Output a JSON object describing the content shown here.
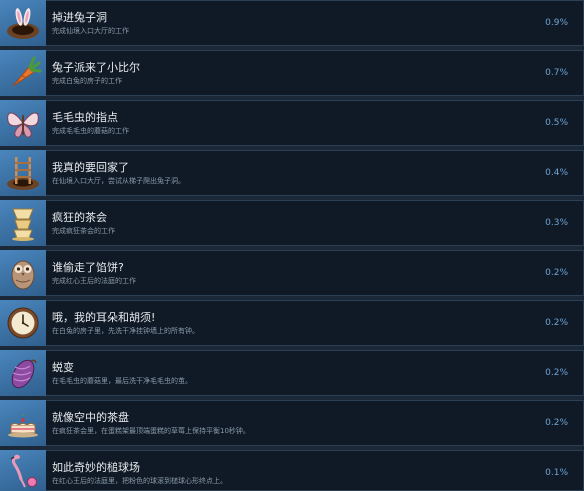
{
  "achievements": [
    {
      "title": "掉进兔子洞",
      "desc": "完成仙境入口大厅的工作",
      "pct": "0.9%",
      "icon": "rabbit-hole-icon"
    },
    {
      "title": "兔子派来了小比尔",
      "desc": "完成白兔的房子的工作",
      "pct": "0.7%",
      "icon": "carrot-icon"
    },
    {
      "title": "毛毛虫的指点",
      "desc": "完成毛毛虫的蘑菇的工作",
      "pct": "0.5%",
      "icon": "butterfly-icon"
    },
    {
      "title": "我真的要回家了",
      "desc": "在仙境入口大厅，尝试从梯子爬出兔子洞。",
      "pct": "0.4%",
      "icon": "ladder-icon"
    },
    {
      "title": "疯狂的茶会",
      "desc": "完成疯狂茶会的工作",
      "pct": "0.3%",
      "icon": "teacup-icon"
    },
    {
      "title": "谁偷走了馅饼?",
      "desc": "完成红心王后的法庭的工作",
      "pct": "0.2%",
      "icon": "owl-icon"
    },
    {
      "title": "哦，我的耳朵和胡须!",
      "desc": "在白兔的房子里，先洗干净挂钟墙上的所有钟。",
      "pct": "0.2%",
      "icon": "clock-icon"
    },
    {
      "title": "蜕变",
      "desc": "在毛毛虫的蘑菇里，最后洗干净毛毛虫的茧。",
      "pct": "0.2%",
      "icon": "cocoon-icon"
    },
    {
      "title": "就像空中的茶盘",
      "desc": "在疯狂茶会里，在蛋糕架最顶端蛋糕的草莓上保持平衡10秒钟。",
      "pct": "0.2%",
      "icon": "cake-icon"
    },
    {
      "title": "如此奇妙的槌球场",
      "desc": "在红心王后的法庭里，把粉色的球滚到槌球心形终点上。",
      "pct": "0.1%",
      "icon": "flamingo-icon"
    }
  ],
  "colors": {
    "background": "#1b2838",
    "panel": "#101a26",
    "icon_bg": "#3a6fa0",
    "title": "#e8ebee",
    "desc": "#8a9aa9",
    "pct": "#6ea3d4"
  }
}
